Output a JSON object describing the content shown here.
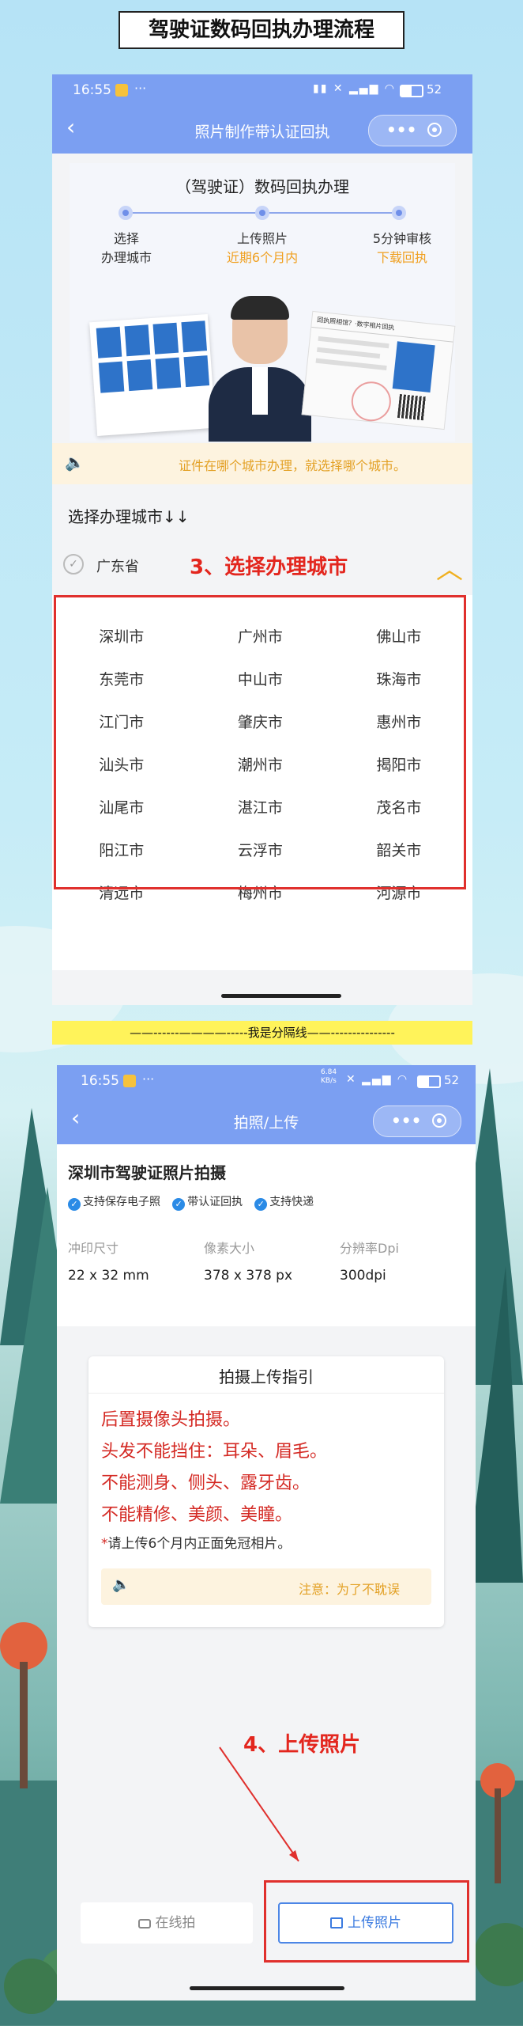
{
  "page_title": "驾驶证数码回执办理流程",
  "screen1": {
    "status": {
      "time": "16:55",
      "battery": "52"
    },
    "nav_title": "照片制作带认证回执",
    "hero_title": "（驾驶证）数码回执办理",
    "steps": [
      {
        "line1": "选择",
        "line2": "办理城市"
      },
      {
        "line1": "上传照片",
        "line2": "近期6个月内"
      },
      {
        "line1": "5分钟审核",
        "line2": "下载回执"
      }
    ],
    "receipt_header": "回执照相馆？·数字相片回执",
    "notice": "证件在哪个城市办理，就选择哪个城市。",
    "select_heading": "选择办理城市↓↓",
    "province": "广东省",
    "annotation3": "3、选择办理城市",
    "cities": [
      [
        "深圳市",
        "广州市",
        "佛山市"
      ],
      [
        "东莞市",
        "中山市",
        "珠海市"
      ],
      [
        "江门市",
        "肇庆市",
        "惠州市"
      ],
      [
        "汕头市",
        "潮州市",
        "揭阳市"
      ],
      [
        "汕尾市",
        "湛江市",
        "茂名市"
      ],
      [
        "阳江市",
        "云浮市",
        "韶关市"
      ],
      [
        "清远市",
        "梅州市",
        "河源市"
      ]
    ]
  },
  "divider": "——------————-----我是分隔线——---------------",
  "screen2": {
    "status": {
      "time": "16:55",
      "battery": "52",
      "speed": "6.84\nKB/s"
    },
    "nav_title": "拍照/上传",
    "product_title": "深圳市驾驶证照片拍摄",
    "chips": [
      "支持保存电子照",
      "带认证回执",
      "支持快递"
    ],
    "specs": [
      {
        "label": "冲印尺寸",
        "value": "22 x 32 mm"
      },
      {
        "label": "像素大小",
        "value": "378 x 378 px"
      },
      {
        "label": "分辨率Dpi",
        "value": "300dpi"
      }
    ],
    "guide_title": "拍摄上传指引",
    "guide_lines": [
      "后置摄像头拍摄。",
      "头发不能挡住：耳朵、眉毛。",
      "不能测身、侧头、露牙齿。",
      "不能精修、美颜、美瞳。"
    ],
    "guide_note_star": "*",
    "guide_note": "请上传6个月内正面免冠相片。",
    "guide_notice": "注意：为了不耽误",
    "annotation4": "4、上传照片",
    "btn_online": "在线拍",
    "btn_upload": "上传照片"
  }
}
